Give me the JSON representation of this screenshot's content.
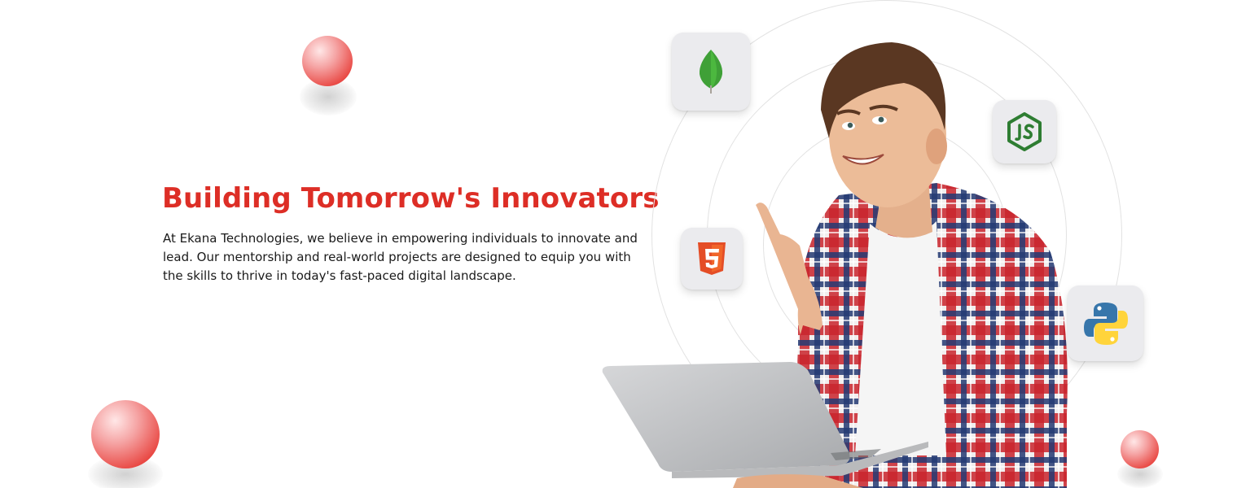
{
  "hero": {
    "title": "Building Tomorrow's Innovators",
    "description": "At Ekana Technologies, we believe in empowering individuals to innovate and lead. Our mentorship and real-world projects are designed to equip you with the skills to thrive in today's fast-paced digital landscape."
  },
  "tech_icons": [
    {
      "name": "mongodb-icon",
      "color": "#3fa037"
    },
    {
      "name": "nodejs-icon",
      "color": "#2e7d32"
    },
    {
      "name": "html5-icon",
      "color": "#e44d26"
    },
    {
      "name": "python-icon",
      "colors": [
        "#3776ab",
        "#ffd43b"
      ]
    }
  ],
  "colors": {
    "accent": "#dd2e26",
    "text": "#1a1a1a",
    "background": "#ffffff",
    "card": "#ebebee"
  }
}
